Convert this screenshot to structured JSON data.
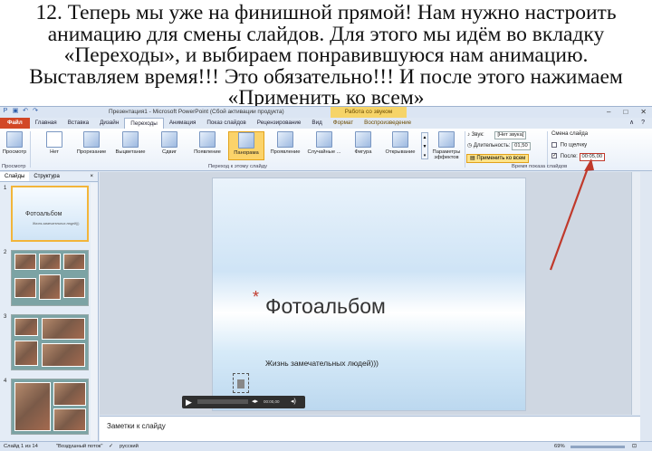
{
  "caption": {
    "lines": [
      "12. Теперь мы уже на финишной прямой! Нам нужно настроить",
      "анимацию для смены слайдов. Для этого мы идём во вкладку",
      "«Переходы», и выбираем понравившуюся нам анимацию.",
      "Выставляем время!!! Это обязательно!!! И после этого нажимаем",
      "«Применить ко всем»"
    ]
  },
  "window": {
    "title": "Презентация1 - Microsoft PowerPoint (Сбой активации продукта)",
    "context_title": "Работа со звуком",
    "help": "?"
  },
  "tabs": [
    "Файл",
    "Главная",
    "Вставка",
    "Дизайн",
    "Переходы",
    "Анимация",
    "Показ слайдов",
    "Рецензирование",
    "Вид",
    "Формат",
    "Воспроизведение"
  ],
  "ribbon": {
    "preview": {
      "label": "Просмотр",
      "group": "Просмотр"
    },
    "transitions": [
      "Нет",
      "Прорезание",
      "Выцветание",
      "Сдвиг",
      "Появление",
      "Панорама",
      "Проявление",
      "Случайные ...",
      "Фигура",
      "Открывание"
    ],
    "selected_transition": "Панорама",
    "effects_label": "Параметры эффектов",
    "group_transition": "Переход к этому слайду",
    "sound_label": "Звук:",
    "sound_value": "[Нет звука]",
    "duration_label": "Длительность:",
    "duration_value": "01,50",
    "apply_all": "Применить ко всем",
    "advance_label": "Смена слайда",
    "on_click": "По щелчку",
    "after_label": "После:",
    "after_value": "00:05,00",
    "group_timing": "Время показа слайдов"
  },
  "panes": {
    "slides_tab": "Слайды",
    "outline_tab": "Структура",
    "close": "×"
  },
  "thumbnails": [
    {
      "num": "1",
      "title": "Фотоальбом",
      "subtitle": "Жизнь замечательных людей)))"
    },
    {
      "num": "2"
    },
    {
      "num": "3"
    },
    {
      "num": "4"
    }
  ],
  "slide": {
    "title": "Фотоальбом",
    "subtitle": "Жизнь замечательных людей)))",
    "player_time": "00:00,00"
  },
  "notes_placeholder": "Заметки к слайду",
  "status": {
    "slide": "Слайд 1 из 14",
    "theme": "\"Воздушный поток\"",
    "language": "русский",
    "zoom": "69%"
  },
  "colors": {
    "file_tab": "#d24726",
    "selected": "#fbd36a",
    "arrow": "#c0392b"
  }
}
